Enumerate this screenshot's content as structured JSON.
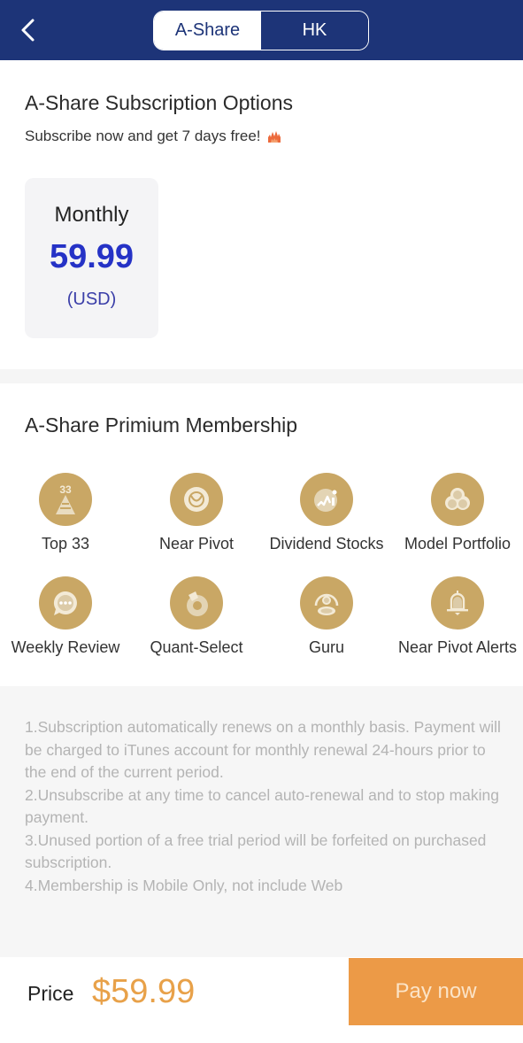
{
  "navbar": {
    "back_icon": "chevron-left-icon",
    "tabs": [
      {
        "label": "A-Share",
        "active": true
      },
      {
        "label": "HK",
        "active": false
      }
    ],
    "colors": {
      "background": "#1d3478",
      "active_tab_bg": "#ffffff"
    }
  },
  "subscription": {
    "title": "A-Share Subscription Options",
    "subtitle": "Subscribe now and get 7 days free!",
    "subtitle_icon": "flame-icon",
    "plans": [
      {
        "name": "Monthly",
        "price": "59.99",
        "currency": "(USD)",
        "selected": true
      }
    ]
  },
  "membership": {
    "title": "A-Share Primium Membership",
    "features": [
      {
        "label": "Top 33",
        "icon": "top33-pyramid-icon"
      },
      {
        "label": "Near Pivot",
        "icon": "pivot-circle-icon"
      },
      {
        "label": "Dividend Stocks",
        "icon": "dividend-chart-icon"
      },
      {
        "label": "Model Portfolio",
        "icon": "portfolio-circles-icon"
      },
      {
        "label": "Weekly Review",
        "icon": "chat-bubble-icon"
      },
      {
        "label": "Quant-Select",
        "icon": "quant-ring-icon"
      },
      {
        "label": "Guru",
        "icon": "guru-person-icon"
      },
      {
        "label": "Near Pivot Alerts",
        "icon": "bell-icon"
      }
    ],
    "icon_color": "#c9a765"
  },
  "notes": [
    "1.Subscription automatically renews on a monthly basis. Payment will be charged to iTunes account for monthly renewal 24-hours prior to the end of the current period.",
    "2.Unsubscribe at any time to cancel auto-renewal and to stop making payment.",
    "3.Unused portion of a free trial period will be forfeited on purchased subscription.",
    "4.Membership is Mobile Only, not include Web"
  ],
  "footer": {
    "price_label": "Price",
    "price_value": "$59.99",
    "pay_button": "Pay now",
    "colors": {
      "price": "#e8a149",
      "pay_button_bg": "#ec9a47"
    }
  }
}
